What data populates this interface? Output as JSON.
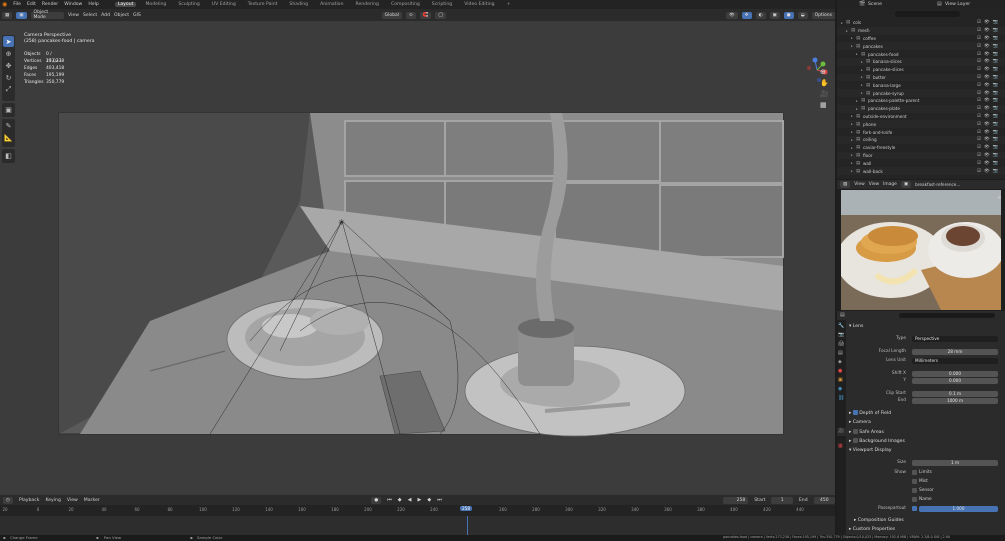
{
  "app": {
    "menu": [
      "File",
      "Edit",
      "Render",
      "Window",
      "Help"
    ],
    "workspaces": [
      "Layout",
      "Modeling",
      "Sculpting",
      "UV Editing",
      "Texture Paint",
      "Shading",
      "Animation",
      "Rendering",
      "Compositing",
      "Scripting",
      "Video Editing"
    ],
    "active_workspace": "Layout",
    "add_tab": "+",
    "scene_name": "Scene",
    "view_layer": "View Layer"
  },
  "viewport_header": {
    "mode": "Object Mode",
    "menus": [
      "View",
      "Select",
      "Add",
      "Object",
      "GIS"
    ],
    "transform": "Global",
    "options": "Options"
  },
  "viewport": {
    "camera_title": "Camera Perspective",
    "camera_sub": "(258) pancakes-food | camera",
    "stats": [
      {
        "label": "Objects",
        "value": "0 / 10,033"
      },
      {
        "label": "Vertices",
        "value": "273,238"
      },
      {
        "label": "Edges",
        "value": "403,418"
      },
      {
        "label": "Faces",
        "value": "195,199"
      },
      {
        "label": "Triangles",
        "value": "350,779"
      }
    ]
  },
  "timeline": {
    "menus": [
      "Playback",
      "Keying",
      "View",
      "Marker"
    ],
    "current_frame": "258",
    "start_label": "Start",
    "start": "1",
    "end_label": "End",
    "end": "450",
    "current_frame_marker": "258",
    "ticks": [
      "20",
      "0",
      "20",
      "40",
      "60",
      "80",
      "100",
      "120",
      "140",
      "160",
      "180",
      "200",
      "220",
      "240",
      "260",
      "280",
      "300",
      "320",
      "340",
      "360",
      "380",
      "400",
      "420",
      "440",
      "460"
    ]
  },
  "statusbar": {
    "left": [
      "Change Frame",
      "Pan View",
      "Sample Color"
    ],
    "right": "pancakes-food | camera | Verts:273,238 | Faces:195,199 | Tris:350,779 | Objects:0/10,033 | Memory: 192.8 MiB | VRAM: 2.3/8.0 GiB | 2.90"
  },
  "outliner": {
    "rows": [
      {
        "name": "cols",
        "indent": 0
      },
      {
        "name": "mesh",
        "indent": 1
      },
      {
        "name": "coffee",
        "indent": 2
      },
      {
        "name": "pancakes",
        "indent": 2
      },
      {
        "name": "pancakes-food",
        "indent": 3
      },
      {
        "name": "banana-slices",
        "indent": 4
      },
      {
        "name": "pancake-slices",
        "indent": 4
      },
      {
        "name": "butter",
        "indent": 4
      },
      {
        "name": "banana-large",
        "indent": 4
      },
      {
        "name": "pancake-syrup",
        "indent": 4
      },
      {
        "name": "pancakes-palette-parent",
        "indent": 3
      },
      {
        "name": "pancakes-plate",
        "indent": 3
      },
      {
        "name": "outside-environment",
        "indent": 2
      },
      {
        "name": "phone",
        "indent": 2
      },
      {
        "name": "fork-and-knife",
        "indent": 2
      },
      {
        "name": "ceiling",
        "indent": 2
      },
      {
        "name": "caviar-freestyle",
        "indent": 2
      },
      {
        "name": "floor",
        "indent": 2
      },
      {
        "name": "wall",
        "indent": 2
      },
      {
        "name": "wall-back",
        "indent": 2
      }
    ]
  },
  "image_editor": {
    "menus": [
      "View",
      "View",
      "Image"
    ],
    "image_name": "breakfast-reference..."
  },
  "properties": {
    "lens_title": "Lens",
    "type_label": "Type",
    "type_value": "Perspective",
    "focal_label": "Focal Length",
    "focal_value": "28 mm",
    "lens_unit_label": "Lens Unit",
    "lens_unit_value": "Millimeters",
    "shift_x_label": "Shift X",
    "shift_x_value": "0.000",
    "shift_y_label": "Y",
    "shift_y_value": "0.000",
    "clip_start_label": "Clip Start",
    "clip_start_value": "0.1 m",
    "clip_end_label": "End",
    "clip_end_value": "1000 m",
    "dof_label": "Depth of Field",
    "camera_label": "Camera",
    "safe_areas_label": "Safe Areas",
    "bg_images_label": "Background Images",
    "viewport_display_label": "Viewport Display",
    "size_label": "Size",
    "size_value": "1 m",
    "show_label": "Show",
    "show_items": [
      "Limits",
      "Mist",
      "Sensor",
      "Name"
    ],
    "passepartout_label": "Passepartout",
    "passepartout_value": "1.000",
    "composition_label": "Composition Guides",
    "custom_props_label": "Custom Properties"
  }
}
